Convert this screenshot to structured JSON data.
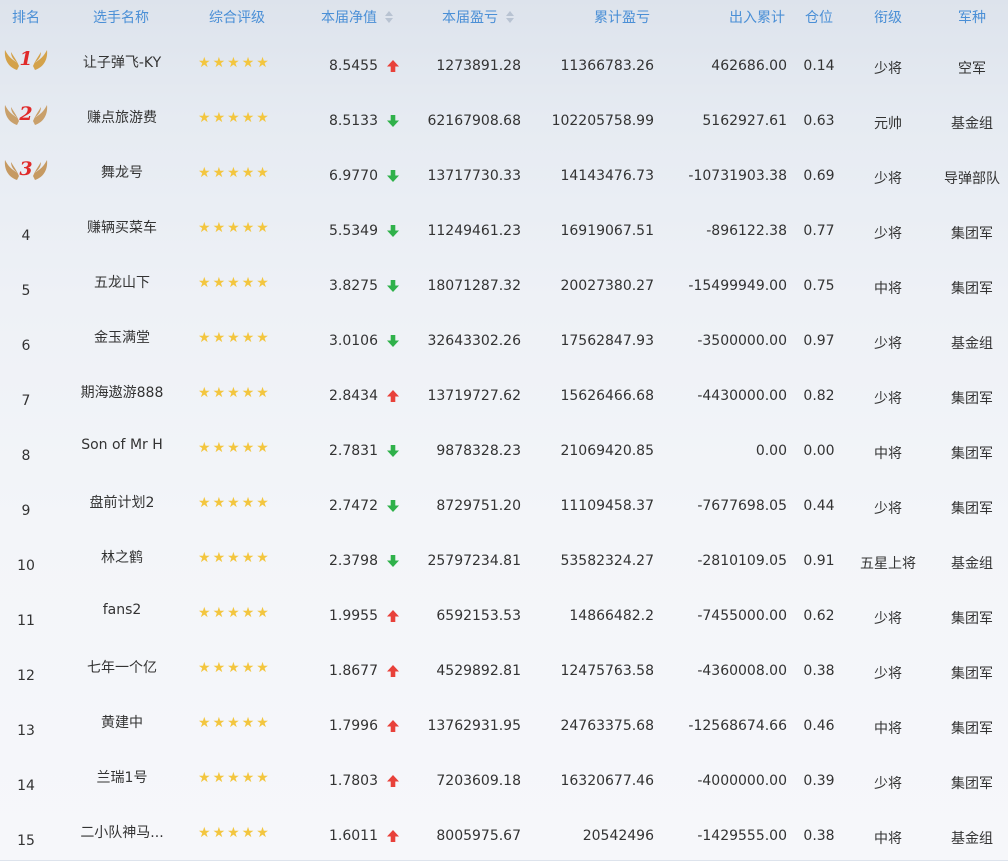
{
  "headers": {
    "rank": "排名",
    "name": "选手名称",
    "rating": "综合评级",
    "nav": "本届净值",
    "current_pl": "本届盈亏",
    "cumulative_pl": "累计盈亏",
    "in_out": "出入累计",
    "position": "仓位",
    "title": "衔级",
    "branch": "军种"
  },
  "colors": {
    "header_text": "#4a8fd6",
    "up_arrow": "#e8413a",
    "down_arrow": "#2fb14a",
    "star": "#f3c63f",
    "medal_number": "#e02a2a"
  },
  "rows": [
    {
      "rank": "1",
      "name": "让子弹飞-KY",
      "stars": 5,
      "nav": "8.5455",
      "trend": "up",
      "current_pl": "1273891.28",
      "cumulative_pl": "11366783.26",
      "in_out": "462686.00",
      "position": "0.14",
      "title": "少将",
      "branch": "空军",
      "medal": "gold"
    },
    {
      "rank": "2",
      "name": "赚点旅游费",
      "stars": 5,
      "nav": "8.5133",
      "trend": "down",
      "current_pl": "62167908.68",
      "cumulative_pl": "102205758.99",
      "in_out": "5162927.61",
      "position": "0.63",
      "title": "元帅",
      "branch": "基金组",
      "medal": "silver"
    },
    {
      "rank": "3",
      "name": "舞龙号",
      "stars": 5,
      "nav": "6.9770",
      "trend": "down",
      "current_pl": "13717730.33",
      "cumulative_pl": "14143476.73",
      "in_out": "-10731903.38",
      "position": "0.69",
      "title": "少将",
      "branch": "导弹部队",
      "medal": "bronze"
    },
    {
      "rank": "4",
      "name": "赚辆买菜车",
      "stars": 5,
      "nav": "5.5349",
      "trend": "down",
      "current_pl": "11249461.23",
      "cumulative_pl": "16919067.51",
      "in_out": "-896122.38",
      "position": "0.77",
      "title": "少将",
      "branch": "集团军"
    },
    {
      "rank": "5",
      "name": "五龙山下",
      "stars": 5,
      "nav": "3.8275",
      "trend": "down",
      "current_pl": "18071287.32",
      "cumulative_pl": "20027380.27",
      "in_out": "-15499949.00",
      "position": "0.75",
      "title": "中将",
      "branch": "集团军"
    },
    {
      "rank": "6",
      "name": "金玉满堂",
      "stars": 5,
      "nav": "3.0106",
      "trend": "down",
      "current_pl": "32643302.26",
      "cumulative_pl": "17562847.93",
      "in_out": "-3500000.00",
      "position": "0.97",
      "title": "少将",
      "branch": "基金组"
    },
    {
      "rank": "7",
      "name": "期海遨游888",
      "stars": 5,
      "nav": "2.8434",
      "trend": "up",
      "current_pl": "13719727.62",
      "cumulative_pl": "15626466.68",
      "in_out": "-4430000.00",
      "position": "0.82",
      "title": "少将",
      "branch": "集团军"
    },
    {
      "rank": "8",
      "name": "Son of Mr H",
      "stars": 5,
      "nav": "2.7831",
      "trend": "down",
      "current_pl": "9878328.23",
      "cumulative_pl": "21069420.85",
      "in_out": "0.00",
      "position": "0.00",
      "title": "中将",
      "branch": "集团军"
    },
    {
      "rank": "9",
      "name": "盘前计划2",
      "stars": 5,
      "nav": "2.7472",
      "trend": "down",
      "current_pl": "8729751.20",
      "cumulative_pl": "11109458.37",
      "in_out": "-7677698.05",
      "position": "0.44",
      "title": "少将",
      "branch": "集团军"
    },
    {
      "rank": "10",
      "name": "林之鹤",
      "stars": 5,
      "nav": "2.3798",
      "trend": "down",
      "current_pl": "25797234.81",
      "cumulative_pl": "53582324.27",
      "in_out": "-2810109.05",
      "position": "0.91",
      "title": "五星上将",
      "branch": "基金组"
    },
    {
      "rank": "11",
      "name": "fans2",
      "stars": 5,
      "nav": "1.9955",
      "trend": "up",
      "current_pl": "6592153.53",
      "cumulative_pl": "14866482.2",
      "in_out": "-7455000.00",
      "position": "0.62",
      "title": "少将",
      "branch": "集团军"
    },
    {
      "rank": "12",
      "name": "七年一个亿",
      "stars": 5,
      "nav": "1.8677",
      "trend": "up",
      "current_pl": "4529892.81",
      "cumulative_pl": "12475763.58",
      "in_out": "-4360008.00",
      "position": "0.38",
      "title": "少将",
      "branch": "集团军"
    },
    {
      "rank": "13",
      "name": "黄建中",
      "stars": 5,
      "nav": "1.7996",
      "trend": "up",
      "current_pl": "13762931.95",
      "cumulative_pl": "24763375.68",
      "in_out": "-12568674.66",
      "position": "0.46",
      "title": "中将",
      "branch": "集团军"
    },
    {
      "rank": "14",
      "name": "兰瑞1号",
      "stars": 5,
      "nav": "1.7803",
      "trend": "up",
      "current_pl": "7203609.18",
      "cumulative_pl": "16320677.46",
      "in_out": "-4000000.00",
      "position": "0.39",
      "title": "少将",
      "branch": "集团军"
    },
    {
      "rank": "15",
      "name": "二小队神马...",
      "stars": 5,
      "nav": "1.6011",
      "trend": "up",
      "current_pl": "8005975.67",
      "cumulative_pl": "20542496",
      "in_out": "-1429555.00",
      "position": "0.38",
      "title": "中将",
      "branch": "基金组"
    }
  ]
}
